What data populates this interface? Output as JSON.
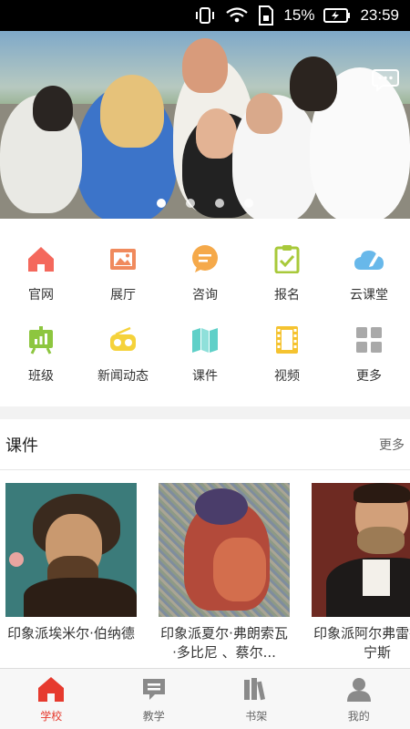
{
  "status_bar": {
    "battery_percent": "15%",
    "time": "23:59"
  },
  "banner": {
    "slide_count": 4,
    "active_index": 0,
    "message_icon": "chat-bubble-icon"
  },
  "menu": [
    {
      "label": "官网",
      "icon": "home-icon",
      "color": "#f4685c"
    },
    {
      "label": "展厅",
      "icon": "picture-frame-icon",
      "color": "#f08a5d"
    },
    {
      "label": "咨询",
      "icon": "chat-icon",
      "color": "#f5a94a"
    },
    {
      "label": "报名",
      "icon": "clipboard-check-icon",
      "color": "#a8c93a"
    },
    {
      "label": "云课堂",
      "icon": "cloud-pen-icon",
      "color": "#68b8ea"
    },
    {
      "label": "班级",
      "icon": "chalkboard-icon",
      "color": "#8dc63f"
    },
    {
      "label": "新闻动态",
      "icon": "radio-icon",
      "color": "#f5d23a"
    },
    {
      "label": "课件",
      "icon": "map-icon",
      "color": "#5fd0c8"
    },
    {
      "label": "视频",
      "icon": "film-icon",
      "color": "#f5c330"
    },
    {
      "label": "更多",
      "icon": "grid-icon",
      "color": "#a9a9a9"
    }
  ],
  "courseware": {
    "title": "课件",
    "more": "更多",
    "items": [
      {
        "title": "印象派埃米尔·伯纳德"
      },
      {
        "title": "印象派夏尔·弗朗索瓦·多比尼 、蔡尔..."
      },
      {
        "title": "印象派阿尔弗雷德·芒宁斯"
      }
    ]
  },
  "tabbar": {
    "tabs": [
      {
        "label": "学校",
        "icon": "school-icon",
        "active": true
      },
      {
        "label": "教学",
        "icon": "teaching-icon",
        "active": false
      },
      {
        "label": "书架",
        "icon": "bookshelf-icon",
        "active": false
      },
      {
        "label": "我的",
        "icon": "user-icon",
        "active": false
      }
    ],
    "active_color": "#e63a2e",
    "inactive_color": "#8a8a8a"
  }
}
